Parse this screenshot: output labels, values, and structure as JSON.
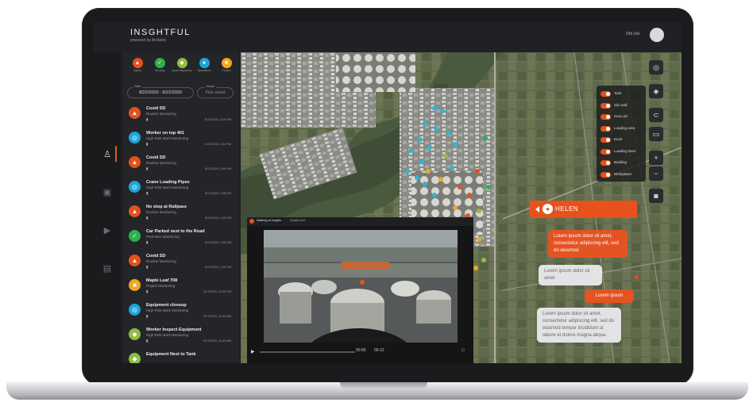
{
  "app": {
    "brand": "INSGHTFUL",
    "brand_sub": "powered by Arobotic",
    "user_name": "Olli Zei"
  },
  "filters": [
    {
      "label": "Safety",
      "color": "#e4511d",
      "glyph": "▲"
    },
    {
      "label": "Security",
      "color": "#2bb24c",
      "glyph": "✓"
    },
    {
      "label": "Asset Inspection",
      "color": "#8dbf3f",
      "glyph": "◆"
    },
    {
      "label": "Operations",
      "color": "#1aa7d8",
      "glyph": "●"
    },
    {
      "label": "Project",
      "color": "#f2a81d",
      "glyph": "■"
    }
  ],
  "date_range": {
    "tag": "Date",
    "value": "8/22/2020 - 9/22/2020"
  },
  "asset": {
    "tag": "Asset",
    "placeholder": "Pick asset"
  },
  "events": [
    {
      "title": "Covid SD",
      "subtitle": "Routine Monitoring",
      "time": "9/17/2020, 3:06 PM",
      "color": "#e4511d",
      "glyph": "▲"
    },
    {
      "title": "Worker on top 401",
      "subtitle": "High Risk Work Monitoring",
      "time": "9/17/2020, 2:52 PM",
      "color": "#1aa7d8",
      "glyph": "◎"
    },
    {
      "title": "Covid SD",
      "subtitle": "Routine Monitoring",
      "time": "9/17/2020, 2:50 PM",
      "color": "#e4511d",
      "glyph": "▲"
    },
    {
      "title": "Crane Loading Pipes",
      "subtitle": "High Risk Work Monitoring",
      "time": "9/17/2020, 2:48 PM",
      "color": "#1aa7d8",
      "glyph": "◎"
    },
    {
      "title": "No stop at Railpass",
      "subtitle": "Routine Monitoring",
      "time": "9/17/2020, 1:45 PM",
      "color": "#e4511d",
      "glyph": "▲"
    },
    {
      "title": "Car Parked next to the Road",
      "subtitle": "Perimeter Monitoring",
      "time": "9/17/2020, 1:25 PM",
      "color": "#2bb24c",
      "glyph": "✓"
    },
    {
      "title": "Covid SD",
      "subtitle": "Routine Monitoring",
      "time": "9/17/2020, 1:10 PM",
      "color": "#e4511d",
      "glyph": "▲"
    },
    {
      "title": "Maple Leaf 708",
      "subtitle": "Project Monitoring",
      "time": "9/17/2020, 12:30 PM",
      "color": "#f2a81d",
      "glyph": "■"
    },
    {
      "title": "Equipment closeup",
      "subtitle": "High Risk Work Monitoring",
      "time": "9/17/2020, 10:45 AM",
      "color": "#1aa7d8",
      "glyph": "◎"
    },
    {
      "title": "Worker Inspect Equipment",
      "subtitle": "High Risk Work Monitoring",
      "time": "9/17/2020, 10:40 AM",
      "color": "#8dbf3f",
      "glyph": "◆"
    },
    {
      "title": "Equipment Next to Tank",
      "subtitle": "",
      "time": "",
      "color": "#8dbf3f",
      "glyph": "◆"
    }
  ],
  "layers": [
    {
      "label": "Tank"
    },
    {
      "label": "Silo wall"
    },
    {
      "label": "Issue pit"
    },
    {
      "label": "Loading area"
    },
    {
      "label": "Dock"
    },
    {
      "label": "Loading shed"
    },
    {
      "label": "Building"
    },
    {
      "label": "Writeplates"
    }
  ],
  "map_controls": {
    "locate": "◎",
    "layers": "◈",
    "toggle": "⊂",
    "screen": "▭",
    "zoom_in": "+",
    "zoom_out": "−",
    "camera": "◙"
  },
  "video": {
    "tag": "Walking at heights",
    "tag2": "Details text",
    "time": "00:00",
    "duration": "00:12"
  },
  "chat": {
    "title": "HELEN",
    "messages": [
      {
        "from": "me",
        "text": "Lorem ipsum dolor sit amet, consectetur adipiscing elit, sed do eiusmod."
      },
      {
        "from": "them",
        "text": "Lorem ipsum dolor sit amet"
      },
      {
        "from": "me",
        "text": "Lorem ipsum"
      },
      {
        "from": "them",
        "text": "Lorem ipsum dolor sit amet, consectetur adipiscing elit, sed do eiusmod tempor incididunt ut labore et dolore magna aliqua."
      }
    ]
  },
  "colors": {
    "accent": "#e4511d",
    "panel": "#242528",
    "background": "#1f2023"
  }
}
